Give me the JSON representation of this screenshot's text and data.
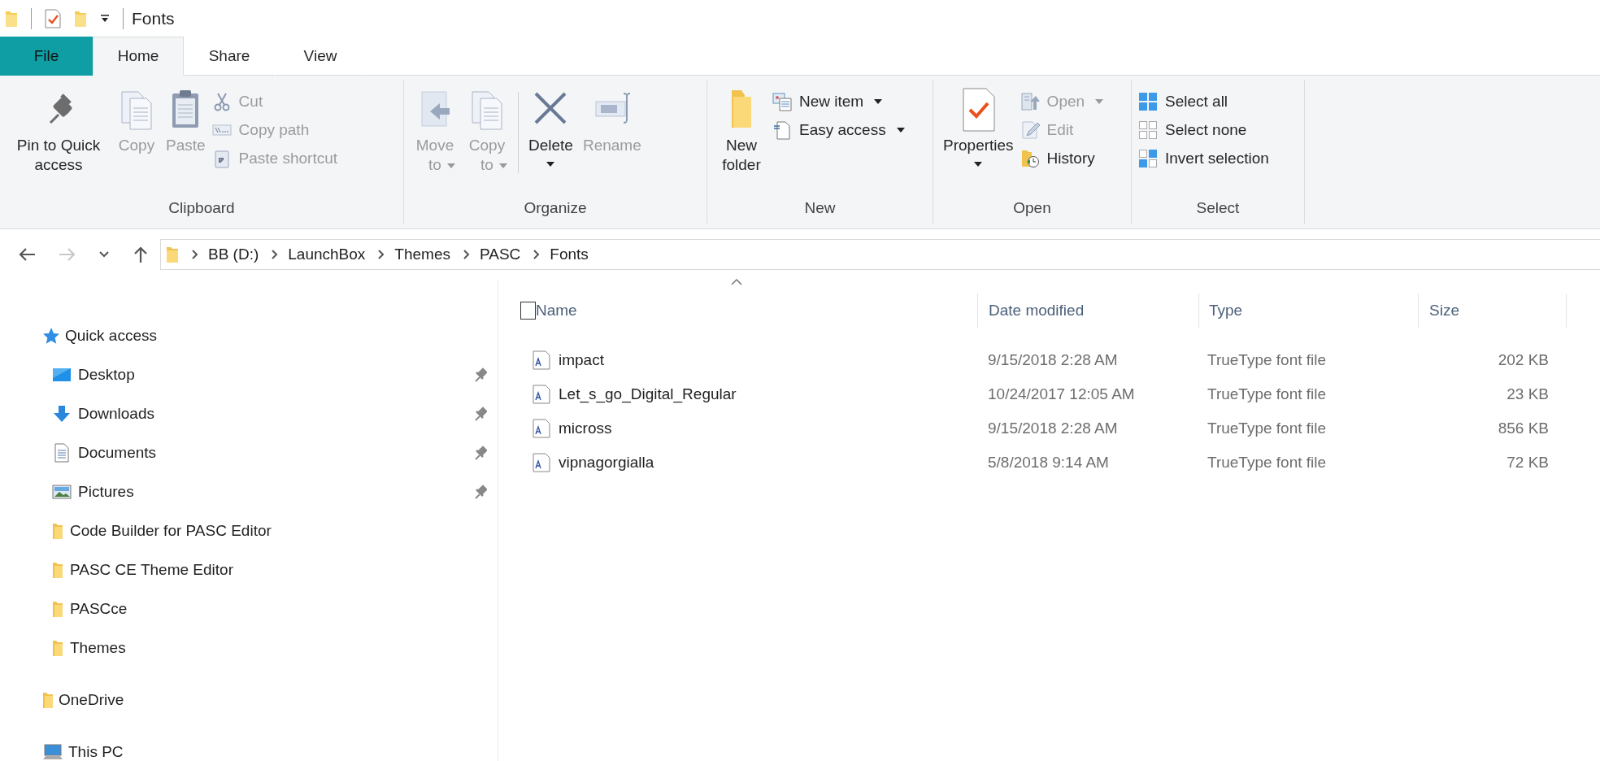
{
  "window": {
    "title": "Fonts"
  },
  "ribbon": {
    "tabs": [
      {
        "label": "File",
        "kind": "file",
        "selected": false
      },
      {
        "label": "Home",
        "kind": "tab",
        "selected": true
      },
      {
        "label": "Share",
        "kind": "tab",
        "selected": false
      },
      {
        "label": "View",
        "kind": "tab",
        "selected": false
      }
    ],
    "groups": [
      {
        "label": "Clipboard",
        "buttons": [
          {
            "label": "Pin to Quick access",
            "kind": "large",
            "disabled": false,
            "dropdown": false
          },
          {
            "label": "Copy",
            "kind": "large",
            "disabled": true,
            "dropdown": false
          },
          {
            "label": "Paste",
            "kind": "large",
            "disabled": true,
            "dropdown": false
          },
          {
            "label": "Cut",
            "kind": "small",
            "disabled": true,
            "dropdown": false
          },
          {
            "label": "Copy path",
            "kind": "small",
            "disabled": true,
            "dropdown": false
          },
          {
            "label": "Paste shortcut",
            "kind": "small",
            "disabled": true,
            "dropdown": false
          }
        ]
      },
      {
        "label": "Organize",
        "buttons": [
          {
            "label": "Move to",
            "kind": "large",
            "disabled": true,
            "dropdown": true
          },
          {
            "label": "Copy to",
            "kind": "large",
            "disabled": true,
            "dropdown": true
          },
          {
            "label": "Delete",
            "kind": "large",
            "disabled": false,
            "dropdown": true
          },
          {
            "label": "Rename",
            "kind": "large",
            "disabled": true,
            "dropdown": false
          }
        ]
      },
      {
        "label": "New",
        "buttons": [
          {
            "label": "New folder",
            "kind": "large",
            "disabled": false,
            "dropdown": false
          },
          {
            "label": "New item",
            "kind": "small",
            "disabled": false,
            "dropdown": true
          },
          {
            "label": "Easy access",
            "kind": "small",
            "disabled": false,
            "dropdown": true
          }
        ]
      },
      {
        "label": "Open",
        "buttons": [
          {
            "label": "Properties",
            "kind": "large",
            "disabled": false,
            "dropdown": true
          },
          {
            "label": "Open",
            "kind": "small",
            "disabled": true,
            "dropdown": true
          },
          {
            "label": "Edit",
            "kind": "small",
            "disabled": true,
            "dropdown": false
          },
          {
            "label": "History",
            "kind": "small",
            "disabled": false,
            "dropdown": false
          }
        ]
      },
      {
        "label": "Select",
        "buttons": [
          {
            "label": "Select all",
            "kind": "small",
            "disabled": false,
            "dropdown": false
          },
          {
            "label": "Select none",
            "kind": "small",
            "disabled": false,
            "dropdown": false
          },
          {
            "label": "Invert selection",
            "kind": "small",
            "disabled": false,
            "dropdown": false
          }
        ]
      }
    ]
  },
  "navigation": {
    "back_disabled": false,
    "forward_disabled": true,
    "breadcrumbs": [
      "BB (D:)",
      "LaunchBox",
      "Themes",
      "PASC",
      "Fonts"
    ]
  },
  "sidebar": {
    "items": [
      {
        "label": "Quick access",
        "children": [
          {
            "label": "Desktop",
            "pinned": true
          },
          {
            "label": "Downloads",
            "pinned": true
          },
          {
            "label": "Documents",
            "pinned": true
          },
          {
            "label": "Pictures",
            "pinned": true
          },
          {
            "label": "Code Builder for PASC Editor",
            "pinned": false
          },
          {
            "label": "PASC CE Theme Editor",
            "pinned": false
          },
          {
            "label": "PASCce",
            "pinned": false
          },
          {
            "label": "Themes",
            "pinned": false
          }
        ]
      },
      {
        "label": "OneDrive"
      },
      {
        "label": "This PC"
      }
    ]
  },
  "table": {
    "select_all_checked": false,
    "columns": [
      {
        "label": "Name",
        "sorted": true
      },
      {
        "label": "Date modified",
        "sorted": false
      },
      {
        "label": "Type",
        "sorted": false
      },
      {
        "label": "Size",
        "sorted": false
      }
    ],
    "rows": [
      {
        "name": "impact",
        "date": "9/15/2018 2:28 AM",
        "type": "TrueType font file",
        "size": "202 KB"
      },
      {
        "name": "Let_s_go_Digital_Regular",
        "date": "10/24/2017 12:05 AM",
        "type": "TrueType font file",
        "size": "23 KB"
      },
      {
        "name": "micross",
        "date": "9/15/2018 2:28 AM",
        "type": "TrueType font file",
        "size": "856 KB"
      },
      {
        "name": "vipnagorgialla",
        "date": "5/8/2018 9:14 AM",
        "type": "TrueType font file",
        "size": "72 KB"
      }
    ]
  }
}
